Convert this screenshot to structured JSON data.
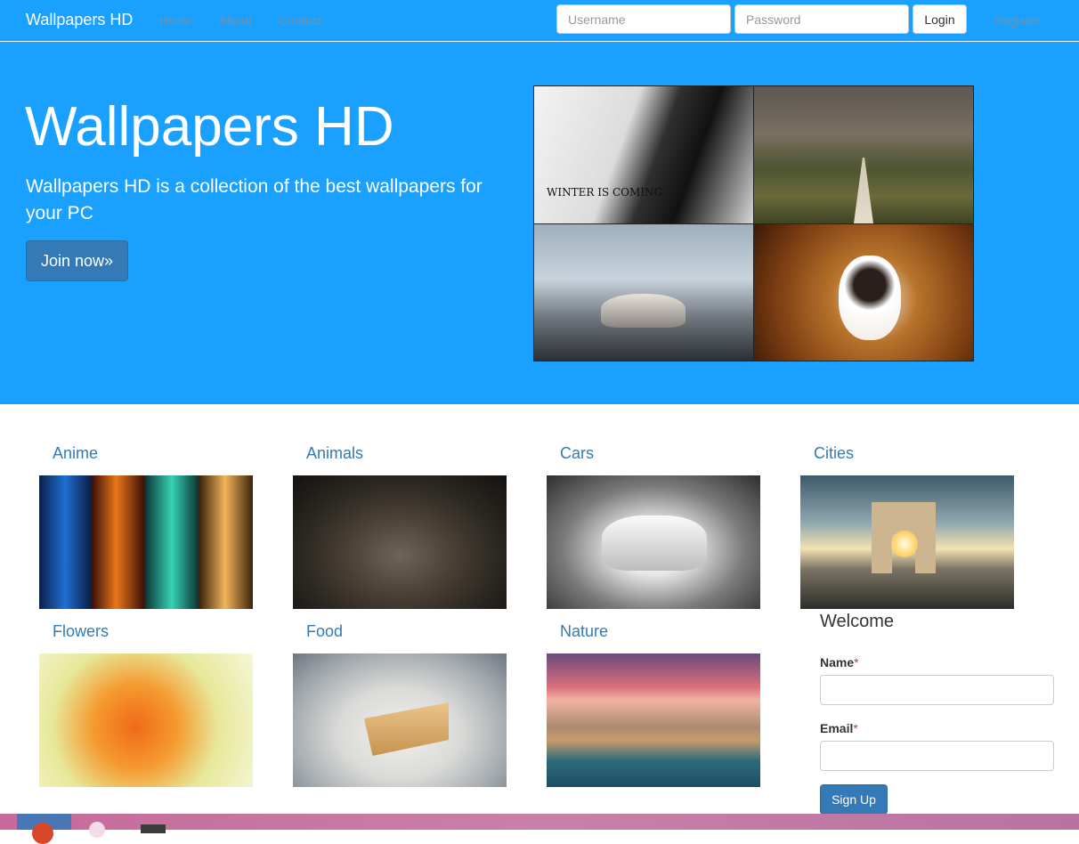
{
  "navbar": {
    "brand": "Wallpapers HD",
    "links": [
      "Home",
      "About",
      "Contact"
    ],
    "username_placeholder": "Username",
    "password_placeholder": "Password",
    "login_label": "Login",
    "register_label": "Register"
  },
  "hero": {
    "title": "Wallpapers HD",
    "text": "Wallpapers HD is a collection of the best wallpapers for your PC",
    "button_label": "Join now»",
    "collage_caption": "WINTER IS COMING"
  },
  "categories": [
    "Anime",
    "Animals",
    "Cars",
    "Cities",
    "Flowers",
    "Food",
    "Nature"
  ],
  "signup_form": {
    "title": "Welcome",
    "name_label": "Name",
    "email_label": "Email",
    "required_mark": "*",
    "button_label": "Sign Up"
  },
  "colors": {
    "hero_bg": "#1aa0ff",
    "link": "#337ab7",
    "primary_button": "#337ab7"
  }
}
